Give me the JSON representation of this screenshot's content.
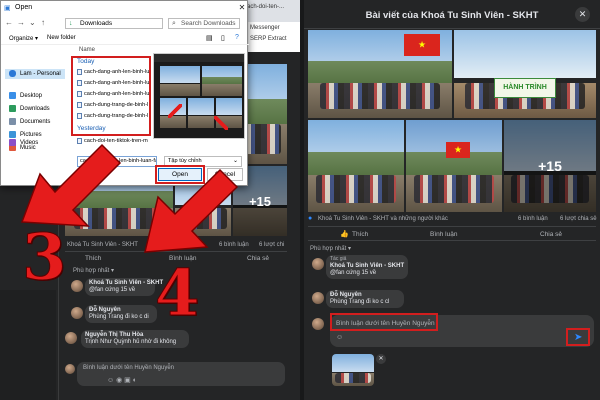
{
  "browser_tabs": [
    "cach-doi-ten-...",
    "Messenger",
    "SERP Extract"
  ],
  "dialog": {
    "title": "Open",
    "address": "Downloads",
    "search_placeholder": "Search Downloads",
    "toolbar": {
      "organize": "Organize ▾",
      "new_folder": "New folder"
    },
    "sidebar": [
      {
        "label": "Lam - Personal",
        "icon": "cloud-icon",
        "color": "#2b78d6"
      },
      {
        "label": "Desktop",
        "icon": "desktop-icon",
        "color": "#3a8fe8"
      },
      {
        "label": "Downloads",
        "icon": "download-icon",
        "color": "#2c9b5d"
      },
      {
        "label": "Documents",
        "icon": "document-icon",
        "color": "#7b8fa8"
      },
      {
        "label": "Pictures",
        "icon": "picture-icon",
        "color": "#3c94d8"
      },
      {
        "label": "Music",
        "icon": "music-icon",
        "color": "#e0573c"
      },
      {
        "label": "Videos",
        "icon": "video-icon",
        "color": "#8b4fc7"
      }
    ],
    "column_header": "Name",
    "groups": {
      "today": "Today",
      "yesterday": "Yesterday"
    },
    "files_today": [
      "cach-dang-anh-len-binh-lu",
      "cach-dang-anh-len-binh-lu",
      "cach-dang-anh-len-binh-lu",
      "cach-dung-trang-de-binh-l",
      "cach-dung-trang-de-binh-l"
    ],
    "files_yesterday": [
      "cach-doi-ten-tiktok-tren-m"
    ],
    "file_name_value": "cach-dang-anh-len-binh-luan-face",
    "file_type": "Tập tùy chỉnh",
    "open_label": "Open",
    "cancel_label": "Cancel"
  },
  "left_post": {
    "overlay_count": "+15",
    "reactions": "Khoá Tu Sinh Viên - SKHT",
    "comments_count": "6 bình luận",
    "shares_count": "6 lượt chi",
    "like_label": "Thích",
    "comment_label": "Bình luận",
    "share_label": "Chia sẻ",
    "sort_label": "Phù hợp nhất ▾",
    "comments": [
      {
        "name": "Khoá Tu Sinh Viên - SKHT",
        "text": "@fan cứng 15 về"
      },
      {
        "name": "Đỗ Nguyên",
        "text": "Phùng Trang đi ko c di"
      },
      {
        "name": "Nguyễn Thị Thu Hòa",
        "text": "Trịnh Như Quỳnh hủ nhờ đi không"
      }
    ],
    "composer_placeholder": "Bình luận dưới tên Huyền Nguyễn"
  },
  "steps": {
    "step3": "3",
    "step4": "4"
  },
  "modal": {
    "title": "Bài viết của Khoá Tu Sinh Viên - SKHT",
    "banner_text": "HÀNH TRÌNH",
    "overlay_count": "+15",
    "reactions": "Khoá Tu Sinh Viên - SKHT và những người khác",
    "comments_count": "6 bình luận",
    "shares_count": "6 lượt chia sẻ",
    "like_label": "Thích",
    "comment_label": "Bình luận",
    "share_label": "Chia sẻ",
    "sort_label": "Phù hợp nhất ▾",
    "comments": [
      {
        "badge": "Tác giả",
        "name": "Khoá Tu Sinh Viên - SKHT",
        "text": "@fan cứng 15 về"
      },
      {
        "badge": "",
        "name": "Đỗ Nguyên",
        "text": "Phùng Trang đi ko c cl"
      }
    ],
    "composer_placeholder": "Bình luận dưới tên Huyền Nguyễn",
    "accent": "#2d88ff"
  },
  "annotation_color": "#d21e1e"
}
